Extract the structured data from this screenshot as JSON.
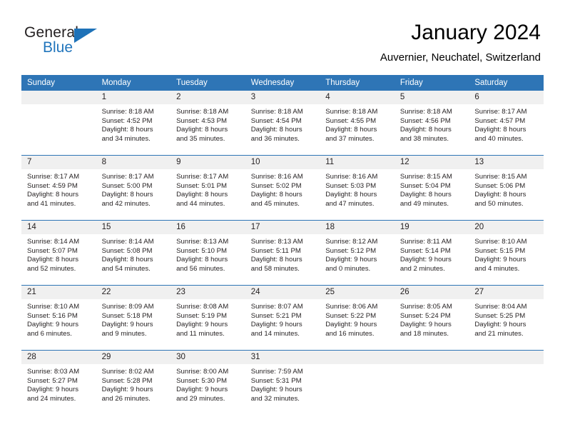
{
  "logo": {
    "text_primary": "General",
    "text_secondary": "Blue",
    "triangle_icon": "triangle-icon"
  },
  "header": {
    "title": "January 2024",
    "subtitle": "Auvernier, Neuchatel, Switzerland"
  },
  "colors": {
    "header_blue": "#2e75b6",
    "logo_blue": "#2175bc",
    "daynum_bg": "#f0f0f0",
    "text": "#231f20"
  },
  "calendar": {
    "weekday_headers": [
      "Sunday",
      "Monday",
      "Tuesday",
      "Wednesday",
      "Thursday",
      "Friday",
      "Saturday"
    ],
    "weeks": [
      [
        {
          "day": "",
          "empty": true,
          "lines": []
        },
        {
          "day": "1",
          "lines": [
            "Sunrise: 8:18 AM",
            "Sunset: 4:52 PM",
            "Daylight: 8 hours",
            "and 34 minutes."
          ]
        },
        {
          "day": "2",
          "lines": [
            "Sunrise: 8:18 AM",
            "Sunset: 4:53 PM",
            "Daylight: 8 hours",
            "and 35 minutes."
          ]
        },
        {
          "day": "3",
          "lines": [
            "Sunrise: 8:18 AM",
            "Sunset: 4:54 PM",
            "Daylight: 8 hours",
            "and 36 minutes."
          ]
        },
        {
          "day": "4",
          "lines": [
            "Sunrise: 8:18 AM",
            "Sunset: 4:55 PM",
            "Daylight: 8 hours",
            "and 37 minutes."
          ]
        },
        {
          "day": "5",
          "lines": [
            "Sunrise: 8:18 AM",
            "Sunset: 4:56 PM",
            "Daylight: 8 hours",
            "and 38 minutes."
          ]
        },
        {
          "day": "6",
          "lines": [
            "Sunrise: 8:17 AM",
            "Sunset: 4:57 PM",
            "Daylight: 8 hours",
            "and 40 minutes."
          ]
        }
      ],
      [
        {
          "day": "7",
          "lines": [
            "Sunrise: 8:17 AM",
            "Sunset: 4:59 PM",
            "Daylight: 8 hours",
            "and 41 minutes."
          ]
        },
        {
          "day": "8",
          "lines": [
            "Sunrise: 8:17 AM",
            "Sunset: 5:00 PM",
            "Daylight: 8 hours",
            "and 42 minutes."
          ]
        },
        {
          "day": "9",
          "lines": [
            "Sunrise: 8:17 AM",
            "Sunset: 5:01 PM",
            "Daylight: 8 hours",
            "and 44 minutes."
          ]
        },
        {
          "day": "10",
          "lines": [
            "Sunrise: 8:16 AM",
            "Sunset: 5:02 PM",
            "Daylight: 8 hours",
            "and 45 minutes."
          ]
        },
        {
          "day": "11",
          "lines": [
            "Sunrise: 8:16 AM",
            "Sunset: 5:03 PM",
            "Daylight: 8 hours",
            "and 47 minutes."
          ]
        },
        {
          "day": "12",
          "lines": [
            "Sunrise: 8:15 AM",
            "Sunset: 5:04 PM",
            "Daylight: 8 hours",
            "and 49 minutes."
          ]
        },
        {
          "day": "13",
          "lines": [
            "Sunrise: 8:15 AM",
            "Sunset: 5:06 PM",
            "Daylight: 8 hours",
            "and 50 minutes."
          ]
        }
      ],
      [
        {
          "day": "14",
          "lines": [
            "Sunrise: 8:14 AM",
            "Sunset: 5:07 PM",
            "Daylight: 8 hours",
            "and 52 minutes."
          ]
        },
        {
          "day": "15",
          "lines": [
            "Sunrise: 8:14 AM",
            "Sunset: 5:08 PM",
            "Daylight: 8 hours",
            "and 54 minutes."
          ]
        },
        {
          "day": "16",
          "lines": [
            "Sunrise: 8:13 AM",
            "Sunset: 5:10 PM",
            "Daylight: 8 hours",
            "and 56 minutes."
          ]
        },
        {
          "day": "17",
          "lines": [
            "Sunrise: 8:13 AM",
            "Sunset: 5:11 PM",
            "Daylight: 8 hours",
            "and 58 minutes."
          ]
        },
        {
          "day": "18",
          "lines": [
            "Sunrise: 8:12 AM",
            "Sunset: 5:12 PM",
            "Daylight: 9 hours",
            "and 0 minutes."
          ]
        },
        {
          "day": "19",
          "lines": [
            "Sunrise: 8:11 AM",
            "Sunset: 5:14 PM",
            "Daylight: 9 hours",
            "and 2 minutes."
          ]
        },
        {
          "day": "20",
          "lines": [
            "Sunrise: 8:10 AM",
            "Sunset: 5:15 PM",
            "Daylight: 9 hours",
            "and 4 minutes."
          ]
        }
      ],
      [
        {
          "day": "21",
          "lines": [
            "Sunrise: 8:10 AM",
            "Sunset: 5:16 PM",
            "Daylight: 9 hours",
            "and 6 minutes."
          ]
        },
        {
          "day": "22",
          "lines": [
            "Sunrise: 8:09 AM",
            "Sunset: 5:18 PM",
            "Daylight: 9 hours",
            "and 9 minutes."
          ]
        },
        {
          "day": "23",
          "lines": [
            "Sunrise: 8:08 AM",
            "Sunset: 5:19 PM",
            "Daylight: 9 hours",
            "and 11 minutes."
          ]
        },
        {
          "day": "24",
          "lines": [
            "Sunrise: 8:07 AM",
            "Sunset: 5:21 PM",
            "Daylight: 9 hours",
            "and 14 minutes."
          ]
        },
        {
          "day": "25",
          "lines": [
            "Sunrise: 8:06 AM",
            "Sunset: 5:22 PM",
            "Daylight: 9 hours",
            "and 16 minutes."
          ]
        },
        {
          "day": "26",
          "lines": [
            "Sunrise: 8:05 AM",
            "Sunset: 5:24 PM",
            "Daylight: 9 hours",
            "and 18 minutes."
          ]
        },
        {
          "day": "27",
          "lines": [
            "Sunrise: 8:04 AM",
            "Sunset: 5:25 PM",
            "Daylight: 9 hours",
            "and 21 minutes."
          ]
        }
      ],
      [
        {
          "day": "28",
          "lines": [
            "Sunrise: 8:03 AM",
            "Sunset: 5:27 PM",
            "Daylight: 9 hours",
            "and 24 minutes."
          ]
        },
        {
          "day": "29",
          "lines": [
            "Sunrise: 8:02 AM",
            "Sunset: 5:28 PM",
            "Daylight: 9 hours",
            "and 26 minutes."
          ]
        },
        {
          "day": "30",
          "lines": [
            "Sunrise: 8:00 AM",
            "Sunset: 5:30 PM",
            "Daylight: 9 hours",
            "and 29 minutes."
          ]
        },
        {
          "day": "31",
          "lines": [
            "Sunrise: 7:59 AM",
            "Sunset: 5:31 PM",
            "Daylight: 9 hours",
            "and 32 minutes."
          ]
        },
        {
          "day": "",
          "empty": true,
          "lines": []
        },
        {
          "day": "",
          "empty": true,
          "lines": []
        },
        {
          "day": "",
          "empty": true,
          "lines": []
        }
      ]
    ]
  }
}
